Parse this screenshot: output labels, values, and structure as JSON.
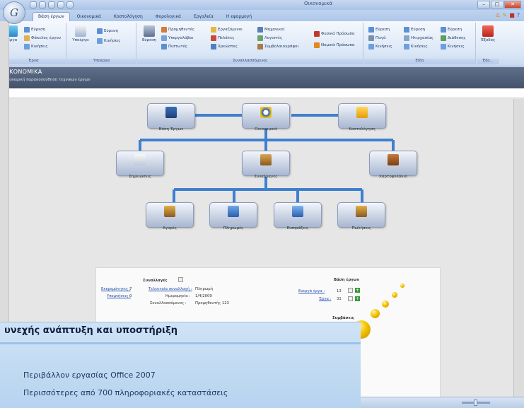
{
  "window": {
    "title": "Οικονομικά",
    "orb_letter": "G",
    "win_min": "–",
    "win_max": "□",
    "win_close": "✕"
  },
  "tabs": [
    {
      "label": "Βάση έργων",
      "active": true
    },
    {
      "label": "Οικονομικά"
    },
    {
      "label": "Κοστολόγηση"
    },
    {
      "label": "Φορολογικά"
    },
    {
      "label": "Εργαλεία"
    },
    {
      "label": "Η εφαρμογή"
    }
  ],
  "ribbon": {
    "erga": {
      "title": "Έργα",
      "big_label": "Έργα",
      "items": [
        "Εύρεση",
        "Φάκελος έργου",
        "Κινήσεις"
      ]
    },
    "ypoerga": {
      "title": "Υποέργα",
      "big_label": "Υποέργα",
      "items": [
        "Εύρεση",
        "Κινήσεις"
      ]
    },
    "synallassomenoi": {
      "title": "Συναλλασσόμενοι",
      "big_label": "Εύρεση",
      "items": [
        "Προμηθευτές",
        "Υπεργολάβοι",
        "Πιστωτές",
        "Εργαζόμενοι",
        "Πελάτες",
        "Χρεώστες",
        "Μηχανικοί",
        "Λογιστές",
        "Συμβολαιογράφοι",
        "Φυσικά Πρόσωπα",
        "Νομικά Πρόσωπα"
      ]
    },
    "eidi": {
      "title": "Είδη",
      "items": [
        "Εύρεση",
        "Παγά",
        "Κινήσεις",
        "Εύρεση",
        "Ητιρχασίας",
        "Κινήσεις",
        "Εύρεση",
        "Διάθεσης",
        "Κινήσεις"
      ]
    },
    "exodos": {
      "title": "Έξο...",
      "big_label": "Έξοδος"
    }
  },
  "section": {
    "title": "ΟΙΚΟΝΟΜΙΚΑ",
    "subtitle": "Οικονομική παρακολούθηση τεχνικών έργων"
  },
  "diagram": {
    "top": [
      "Βάση Έργων",
      "Οικονομικά",
      "Κοστολόγηση"
    ],
    "middle": [
      "Σημειώσεις",
      "Συναλλαγές",
      "Χαρτοφυλάκιο"
    ],
    "bottom": [
      "Αγορές",
      "Πληρωμές",
      "Εισπράξεις",
      "Πωλήσεις"
    ]
  },
  "panel": {
    "synallages_title": "Συναλλαγές",
    "ekkremotites_label": "Εκκρεμότητες :",
    "ekkremotites_val": "7",
    "ypomniseis_label": "Υπομνήσεις :",
    "ypomniseis_val": "0",
    "teleutaia_label": "Τελευταία συναλλαγή :",
    "teleutaia_val": "Πληρωμή",
    "imerominia_label": "Ημερομηνία :",
    "imerominia_val": "1/4/2009",
    "synallassomenos_label": "Συναλλασσόμενος :",
    "synallassomenos_val": "Προμηθευτής 123",
    "vasi_title": "Βάση έργων",
    "energa_label": "Ενεργά έργα :",
    "energa_val": "13",
    "erga_label": "Έργα :",
    "erga_val": "31",
    "symvaseis_title": "Συμβάσεις"
  },
  "banner": {
    "title": "υνεχής ανάπτυξη και υποστήριξη",
    "line1": "Περιβάλλον εργασίας Office 2007",
    "line2": "Περισσότερες από 700 πληροφοριακές καταστάσεις"
  },
  "colors": {
    "accent": "#3f7fd0",
    "ribbon": "#dbe7f6",
    "banner": "#cfe3f5",
    "header": "#4f5f78"
  }
}
